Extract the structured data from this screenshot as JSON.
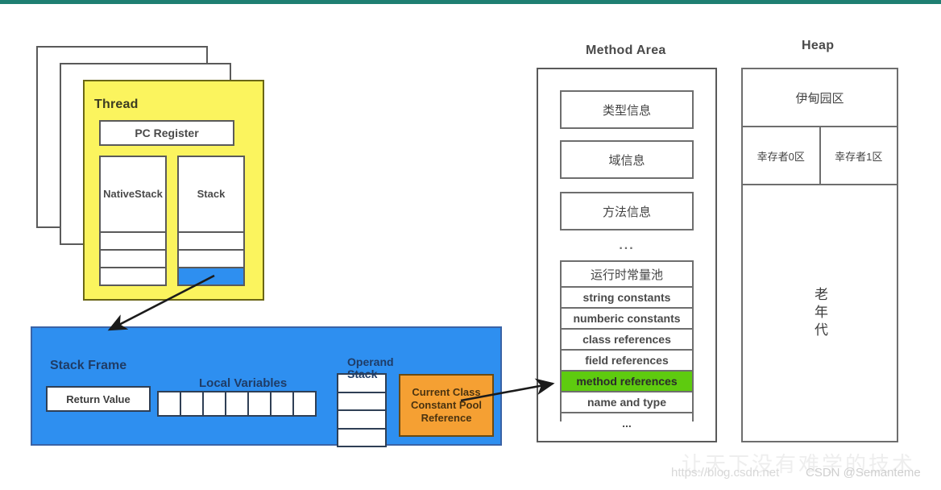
{
  "theme": {
    "accent_teal": "#1e7f72",
    "thread_yellow": "#fbf45e",
    "frame_blue": "#2e8ff0",
    "highlight_green": "#5ecb0f",
    "constant_pool_orange": "#f5a033",
    "box_border_gray": "#5a5a5a"
  },
  "thread": {
    "title": "Thread",
    "pc_register": "PC Register",
    "native_stack": {
      "label": "Native\nStack",
      "label_line1": "Native",
      "label_line2": "Stack",
      "cells": 3,
      "filled_index": -1
    },
    "stack": {
      "label": "Stack",
      "cells": 3,
      "filled_index": 2
    }
  },
  "stack_frame": {
    "title": "Stack Frame",
    "return_value": "Return Value",
    "local_variables_label": "Local Variables",
    "local_variables_count": 7,
    "operand_stack_label_line1": "Operand",
    "operand_stack_label_line2": "Stack",
    "operand_stack_cells": 4,
    "constant_pool_ref_line1": "Current Class",
    "constant_pool_ref_line2": "Constant Pool",
    "constant_pool_ref_line3": "Reference"
  },
  "method_area": {
    "title": "Method Area",
    "items": [
      "类型信息",
      "域信息",
      "方法信息"
    ],
    "ellipsis": "...",
    "constant_pool": {
      "title": "运行时常量池",
      "rows": [
        {
          "label": "string constants",
          "highlighted": false
        },
        {
          "label": "numberic constants",
          "highlighted": false
        },
        {
          "label": "class references",
          "highlighted": false
        },
        {
          "label": "field references",
          "highlighted": false
        },
        {
          "label": "method references",
          "highlighted": true
        },
        {
          "label": "name and type",
          "highlighted": false
        },
        {
          "label": "...",
          "highlighted": false
        }
      ]
    }
  },
  "heap": {
    "title": "Heap",
    "eden": "伊甸园区",
    "survivor_0": "幸存者0区",
    "survivor_1": "幸存者1区",
    "old_generation": "老年代"
  },
  "watermark": {
    "csdn": "CSDN @Semanteme",
    "url": "https://blog.csdn.net"
  }
}
